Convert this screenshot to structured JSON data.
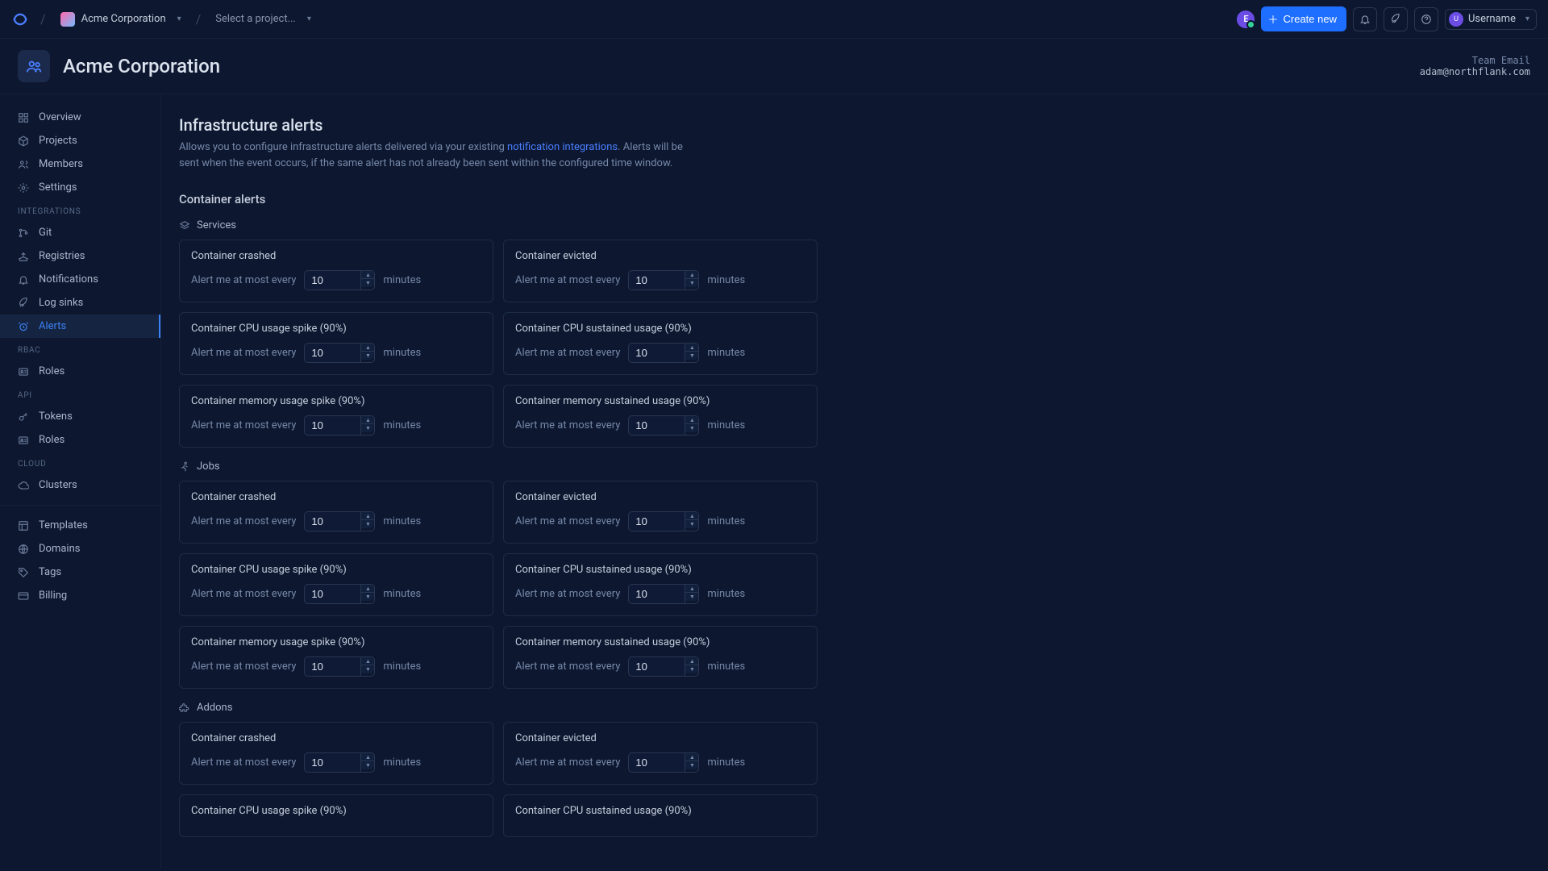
{
  "topbar": {
    "org_name": "Acme Corporation",
    "project_placeholder": "Select a project...",
    "create_label": "Create new",
    "username": "Username",
    "avatar_initial": "E",
    "user_av_initial": "U"
  },
  "org_header": {
    "title": "Acme Corporation",
    "meta_label": "Team Email",
    "meta_value": "adam@northflank.com"
  },
  "sidebar": {
    "main": [
      {
        "label": "Overview",
        "icon": "grid"
      },
      {
        "label": "Projects",
        "icon": "cube"
      },
      {
        "label": "Members",
        "icon": "users"
      },
      {
        "label": "Settings",
        "icon": "gear"
      }
    ],
    "heading_integrations": "INTEGRATIONS",
    "integrations": [
      {
        "label": "Git",
        "icon": "git"
      },
      {
        "label": "Registries",
        "icon": "ship"
      },
      {
        "label": "Notifications",
        "icon": "bell"
      },
      {
        "label": "Log sinks",
        "icon": "rocket"
      },
      {
        "label": "Alerts",
        "icon": "alarm",
        "active": true
      }
    ],
    "heading_rbac": "RBAC",
    "rbac": [
      {
        "label": "Roles",
        "icon": "id"
      }
    ],
    "heading_api": "API",
    "api": [
      {
        "label": "Tokens",
        "icon": "key"
      },
      {
        "label": "Roles",
        "icon": "id"
      }
    ],
    "heading_cloud": "CLOUD",
    "cloud": [
      {
        "label": "Clusters",
        "icon": "cloud"
      }
    ],
    "bottom": [
      {
        "label": "Templates",
        "icon": "template"
      },
      {
        "label": "Domains",
        "icon": "globe"
      },
      {
        "label": "Tags",
        "icon": "tag"
      },
      {
        "label": "Billing",
        "icon": "card"
      }
    ]
  },
  "page": {
    "title": "Infrastructure alerts",
    "desc_pre": "Allows you to configure infrastructure alerts delivered via your existing ",
    "desc_link": "notification integrations",
    "desc_post": ". Alerts will be sent when the event occurs, if the same alert has not already been sent within the configured time window.",
    "section_title": "Container alerts",
    "prefix_label": "Alert me at most every",
    "suffix_label": "minutes",
    "default_value": "10"
  },
  "groups": [
    {
      "name": "Services",
      "icon": "layers",
      "alerts": [
        {
          "title": "Container crashed"
        },
        {
          "title": "Container evicted"
        },
        {
          "title": "Container CPU usage spike (90%)"
        },
        {
          "title": "Container CPU sustained usage (90%)"
        },
        {
          "title": "Container memory usage spike (90%)"
        },
        {
          "title": "Container memory sustained usage (90%)"
        }
      ]
    },
    {
      "name": "Jobs",
      "icon": "running",
      "alerts": [
        {
          "title": "Container crashed"
        },
        {
          "title": "Container evicted"
        },
        {
          "title": "Container CPU usage spike (90%)"
        },
        {
          "title": "Container CPU sustained usage (90%)"
        },
        {
          "title": "Container memory usage spike (90%)"
        },
        {
          "title": "Container memory sustained usage (90%)"
        }
      ]
    },
    {
      "name": "Addons",
      "icon": "puzzle",
      "alerts": [
        {
          "title": "Container crashed"
        },
        {
          "title": "Container evicted"
        },
        {
          "title": "Container CPU usage spike (90%)"
        },
        {
          "title": "Container CPU sustained usage (90%)"
        }
      ]
    }
  ]
}
